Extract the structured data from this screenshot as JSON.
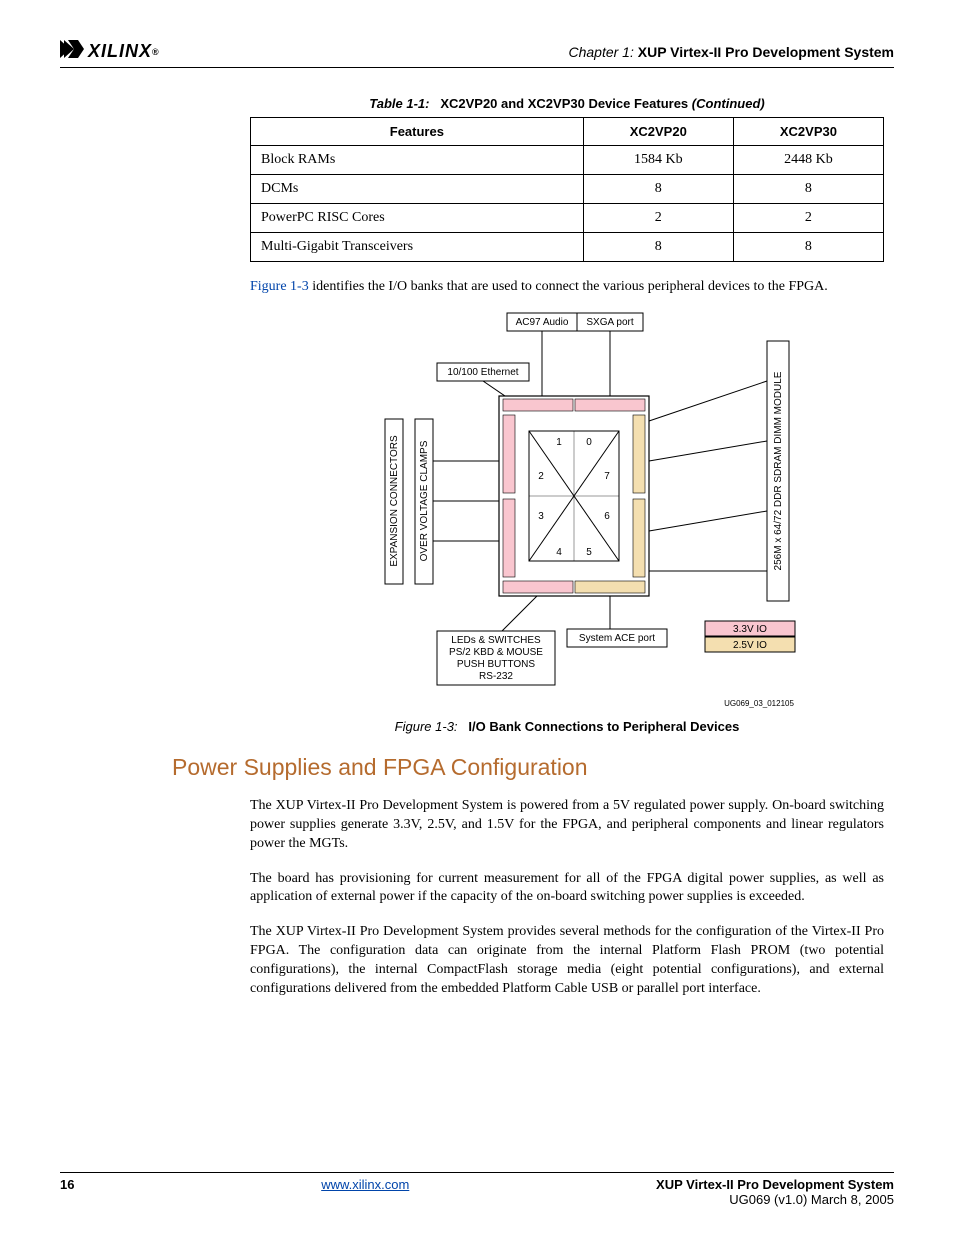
{
  "header": {
    "logo_text": "XILINX",
    "logo_reg": "®",
    "chapter_label": "Chapter 1:",
    "chapter_title": "XUP Virtex-II Pro Development System"
  },
  "table": {
    "caption_prefix": "Table 1-1:",
    "caption_title": "XC2VP20 and XC2VP30 Device Features",
    "caption_suffix": "(Continued)",
    "headers": [
      "Features",
      "XC2VP20",
      "XC2VP30"
    ],
    "rows": [
      {
        "feature": "Block RAMs",
        "c1": "1584 Kb",
        "c2": "2448 Kb"
      },
      {
        "feature": "DCMs",
        "c1": "8",
        "c2": "8"
      },
      {
        "feature": "PowerPC RISC Cores",
        "c1": "2",
        "c2": "2"
      },
      {
        "feature": "Multi-Gigabit Transceivers",
        "c1": "8",
        "c2": "8"
      }
    ]
  },
  "intro_para": {
    "link": "Figure 1-3",
    "rest": " identifies the I/O banks that are used to connect the various peripheral devices to the FPGA."
  },
  "diagram": {
    "ac97": "AC97 Audio",
    "sxga": "SXGA port",
    "ethernet": "10/100 Ethernet",
    "expansion": "EXPANSION CONNECTORS",
    "clamps": "OVER VOLTAGE CLAMPS",
    "dimm": "256M x 64/72 DDR SDRAM DIMM MODULE",
    "banks": {
      "n1": "1",
      "n0": "0",
      "n2": "2",
      "n7": "7",
      "n3": "3",
      "n6": "6",
      "n4": "4",
      "n5": "5"
    },
    "sysace": "System ACE port",
    "bottom_block": {
      "l1": "LEDs & SWITCHES",
      "l2": "PS/2 KBD & MOUSE",
      "l3": "PUSH BUTTONS",
      "l4": "RS-232"
    },
    "io33": "3.3V IO",
    "io25": "2.5V IO",
    "ugcode": "UG069_03_012105"
  },
  "fig_caption": {
    "prefix": "Figure 1-3:",
    "title": "I/O Bank Connections to Peripheral Devices"
  },
  "section_heading": "Power Supplies and FPGA Configuration",
  "body_paras": {
    "p1": "The XUP Virtex-II Pro Development System is powered from a 5V regulated power supply. On-board switching power supplies generate 3.3V, 2.5V, and 1.5V for the FPGA, and peripheral components and linear regulators power the MGTs.",
    "p2": "The board has provisioning for current measurement for all of the FPGA digital power supplies, as well as application of external power if the capacity of the on-board switching power supplies is exceeded.",
    "p3": "The XUP Virtex-II Pro Development System provides several methods for the configuration of the Virtex-II Pro FPGA. The configuration data can originate from the internal Platform Flash PROM (two potential configurations), the internal CompactFlash storage media (eight potential configurations), and external configurations delivered from the embedded Platform Cable USB or parallel port interface."
  },
  "footer": {
    "page_num": "16",
    "url": "www.xilinx.com",
    "doc_title": "XUP  Virtex-II Pro Development System",
    "doc_id": "UG069 (v1.0) March 8, 2005"
  },
  "chart_data": {
    "type": "table",
    "title": "XC2VP20 and XC2VP30 Device Features (Continued)",
    "columns": [
      "Features",
      "XC2VP20",
      "XC2VP30"
    ],
    "rows": [
      [
        "Block RAMs",
        "1584 Kb",
        "2448 Kb"
      ],
      [
        "DCMs",
        8,
        8
      ],
      [
        "PowerPC RISC Cores",
        2,
        2
      ],
      [
        "Multi-Gigabit Transceivers",
        8,
        8
      ]
    ]
  }
}
